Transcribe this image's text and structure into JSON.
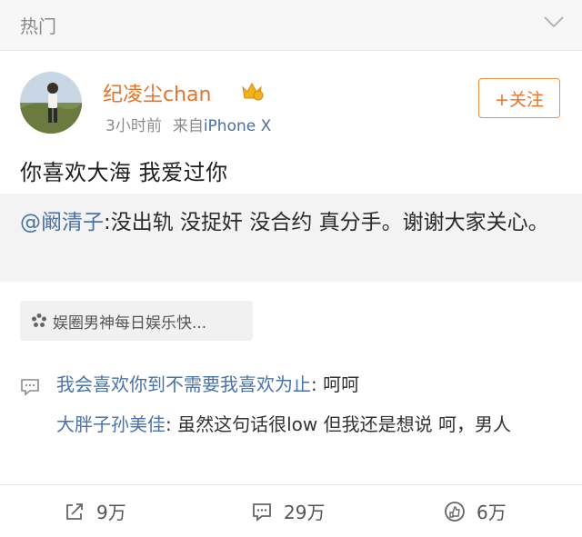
{
  "header": {
    "title": "热门"
  },
  "post": {
    "username": "纪凌尘chan",
    "time": "3小时前",
    "source_prefix": "来自",
    "device": "iPhone X",
    "follow_label": "+关注",
    "text": "你喜欢大海 我爱过你"
  },
  "repost": {
    "mention": "@阚清子",
    "text": ":没出轨 没捉奸 没合约 真分手。谢谢大家关心。"
  },
  "topic": {
    "label": "娱圈男神每日娱乐快..."
  },
  "comments": [
    {
      "author": "我会喜欢你到不需要我喜欢为止",
      "text": ": 呵呵"
    },
    {
      "author": "大胖子孙美佳",
      "text": ": 虽然这句话很low 但我还是想说 呵，男人"
    }
  ],
  "actions": {
    "share": "9万",
    "comment": "29万",
    "like": "6万"
  },
  "colors": {
    "accent": "#e5732a",
    "link": "#4a72a6"
  }
}
